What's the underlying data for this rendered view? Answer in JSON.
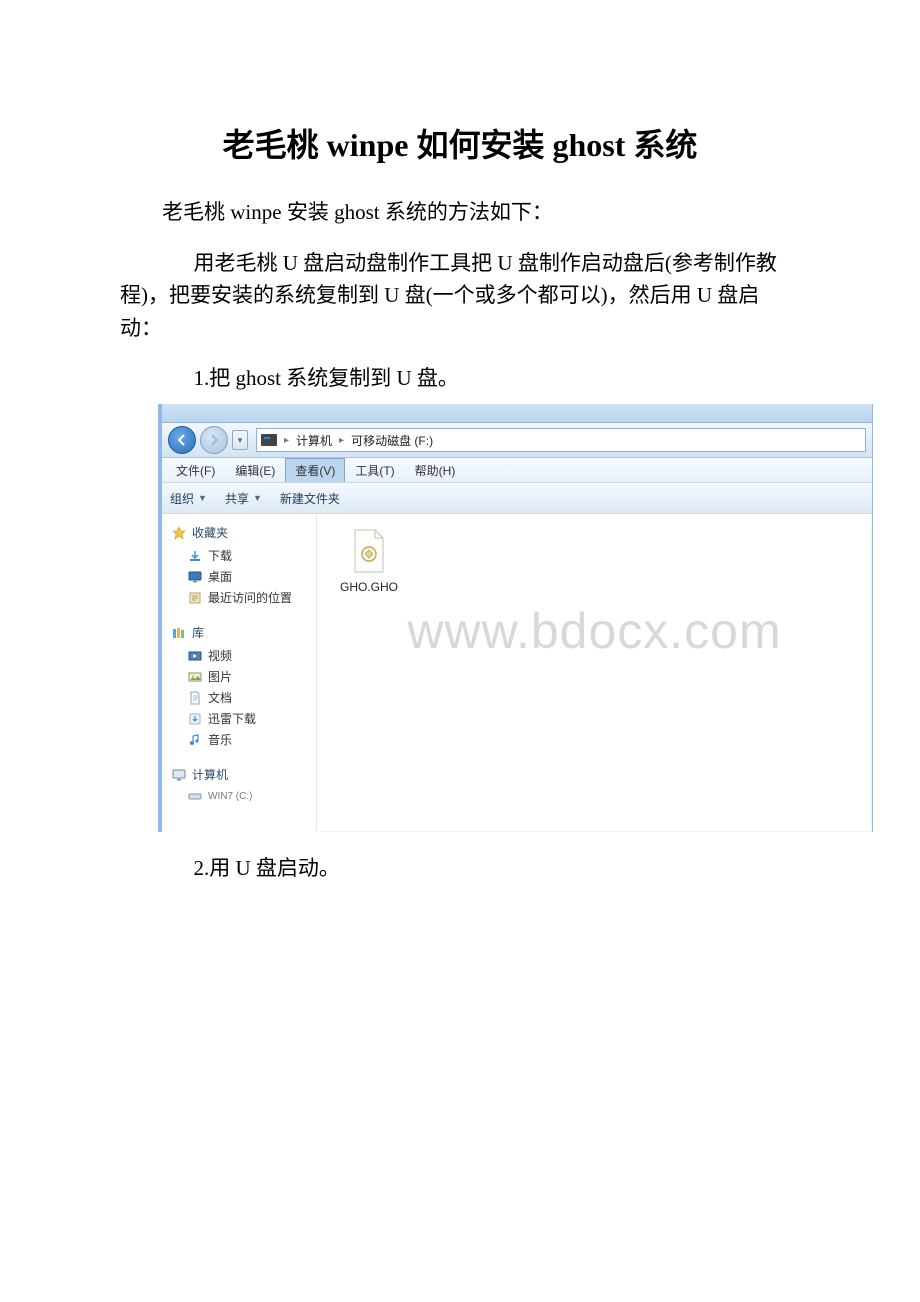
{
  "title": "老毛桃 winpe 如何安装 ghost 系统",
  "intro": "老毛桃 winpe 安装 ghost 系统的方法如下：",
  "desc": "用老毛桃 U 盘启动盘制作工具把 U 盘制作启动盘后(参考制作教程)，把要安装的系统复制到 U 盘(一个或多个都可以)，然后用 U 盘启动：",
  "step1": "1.把 ghost 系统复制到 U 盘。",
  "step2": "2.用 U 盘启动。",
  "watermark": "www.bdocx.com",
  "explorer": {
    "breadcrumb": {
      "root": "计算机",
      "leaf": "可移动磁盘 (F:)"
    },
    "menu": {
      "file": "文件(F)",
      "edit": "编辑(E)",
      "view": "查看(V)",
      "tools": "工具(T)",
      "help": "帮助(H)"
    },
    "cmd": {
      "organize": "组织",
      "share": "共享",
      "newfolder": "新建文件夹"
    },
    "nav": {
      "favorites": "收藏夹",
      "downloads": "下载",
      "desktop": "桌面",
      "recent": "最近访问的位置",
      "libraries": "库",
      "videos": "视频",
      "pictures": "图片",
      "documents": "文档",
      "xunlei": "迅雷下载",
      "music": "音乐",
      "computer": "计算机",
      "win7c": "WIN7 (C:)"
    },
    "file": {
      "name": "GHO.GHO"
    }
  }
}
